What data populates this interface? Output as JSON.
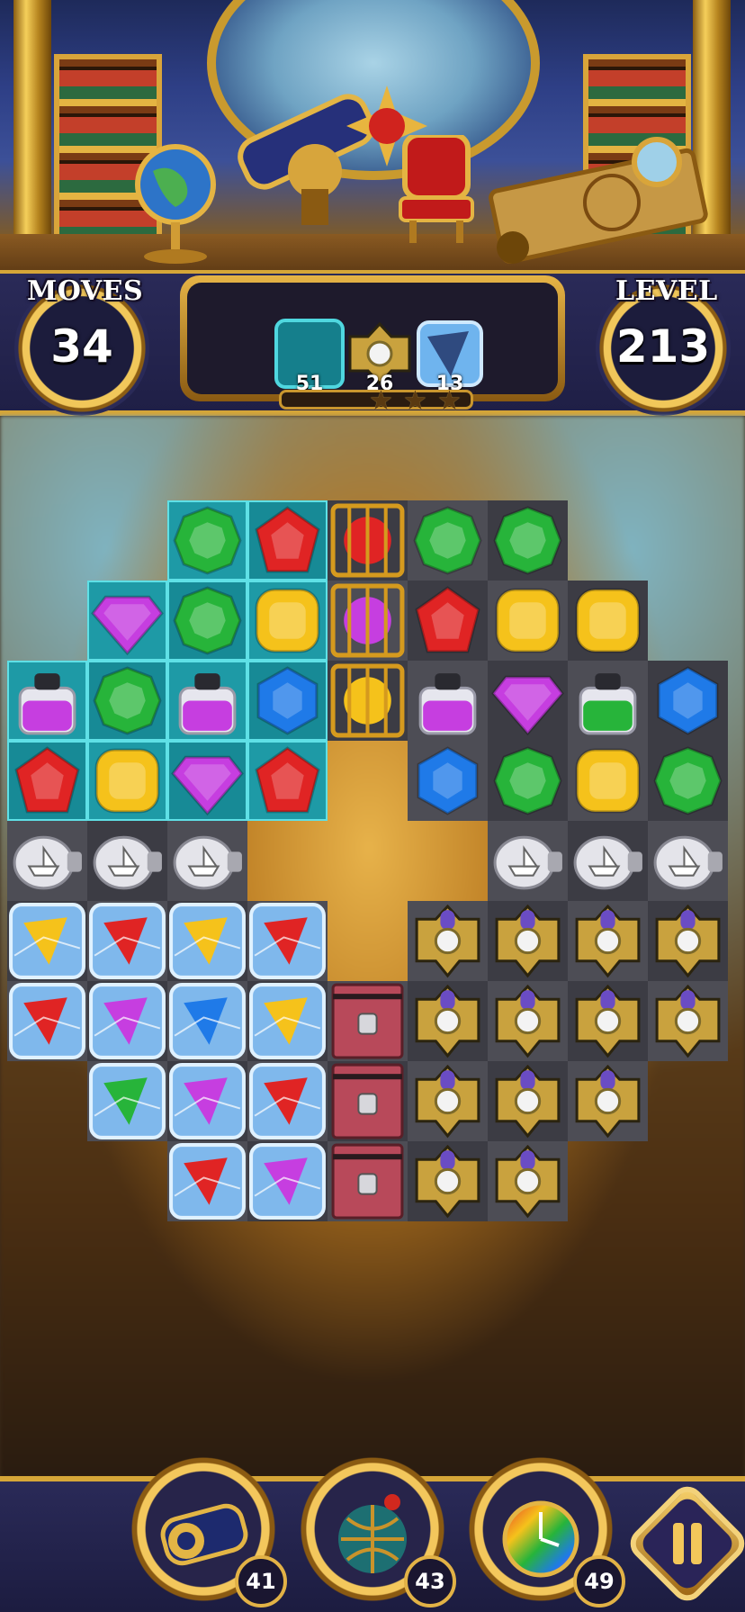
{
  "hud": {
    "moves_label": "MOVES",
    "moves_value": "34",
    "level_label": "LEVEL",
    "level_value": "213",
    "goals": [
      {
        "icon": "teal-tile-goal-icon",
        "count": "51"
      },
      {
        "icon": "golden-clover-goal-icon",
        "count": "26"
      },
      {
        "icon": "ice-block-goal-icon",
        "count": "13"
      }
    ],
    "stars_total": 3
  },
  "boosters": [
    {
      "icon": "cannon-telescope-icon",
      "count": "41"
    },
    {
      "icon": "caged-globe-bomb-icon",
      "count": "43"
    },
    {
      "icon": "rainbow-clock-icon",
      "count": "49"
    }
  ],
  "colors": {
    "red": "#e02424",
    "green": "#27b43a",
    "purple": "#c63ee0",
    "yellow": "#f5c21b",
    "blue": "#1f7ae8",
    "teal": "#1e9aa6",
    "gold": "#d6a638"
  },
  "board": {
    "rows": [
      [
        null,
        null,
        {
          "bg": "teal",
          "p": "green"
        },
        {
          "bg": "teal",
          "p": "red"
        },
        {
          "bg": "dark",
          "p": "caged-red"
        },
        {
          "bg": "light",
          "p": "green"
        },
        {
          "bg": "dark",
          "p": "green"
        },
        null,
        null
      ],
      [
        null,
        {
          "bg": "teal",
          "p": "purple"
        },
        {
          "bg": "teal",
          "p": "green"
        },
        {
          "bg": "teal",
          "p": "yellow"
        },
        {
          "bg": "light",
          "p": "caged-purple"
        },
        {
          "bg": "dark",
          "p": "red"
        },
        {
          "bg": "light",
          "p": "yellow"
        },
        {
          "bg": "dark",
          "p": "yellow"
        },
        null
      ],
      [
        {
          "bg": "teal",
          "p": "potion-purple"
        },
        {
          "bg": "teal",
          "p": "green"
        },
        {
          "bg": "teal",
          "p": "potion-purple"
        },
        {
          "bg": "teal",
          "p": "blue"
        },
        {
          "bg": "dark",
          "p": "caged-yellow"
        },
        {
          "bg": "light",
          "p": "potion-purple"
        },
        {
          "bg": "dark",
          "p": "purple"
        },
        {
          "bg": "light",
          "p": "potion-green"
        },
        {
          "bg": "dark",
          "p": "blue"
        }
      ],
      [
        {
          "bg": "teal",
          "p": "red"
        },
        {
          "bg": "teal",
          "p": "yellow"
        },
        {
          "bg": "teal",
          "p": "purple"
        },
        {
          "bg": "teal",
          "p": "red"
        },
        null,
        {
          "bg": "light",
          "p": "blue"
        },
        {
          "bg": "dark",
          "p": "green"
        },
        {
          "bg": "light",
          "p": "yellow"
        },
        {
          "bg": "dark",
          "p": "green"
        }
      ],
      [
        {
          "bg": "light",
          "p": "bottle"
        },
        {
          "bg": "dark",
          "p": "bottle"
        },
        {
          "bg": "light",
          "p": "bottle"
        },
        null,
        null,
        null,
        {
          "bg": "light",
          "p": "bottle"
        },
        {
          "bg": "dark",
          "p": "bottle"
        },
        {
          "bg": "light",
          "p": "bottle"
        }
      ],
      [
        {
          "bg": "dark",
          "p": "ice-yellow"
        },
        {
          "bg": "light",
          "p": "ice-red"
        },
        {
          "bg": "dark",
          "p": "ice-yellow"
        },
        {
          "bg": "light",
          "p": "ice-red"
        },
        null,
        {
          "bg": "light",
          "p": "clover"
        },
        {
          "bg": "dark",
          "p": "clover"
        },
        {
          "bg": "light",
          "p": "clover"
        },
        {
          "bg": "dark",
          "p": "clover"
        }
      ],
      [
        {
          "bg": "light",
          "p": "ice-red"
        },
        {
          "bg": "dark",
          "p": "ice-purple"
        },
        {
          "bg": "light",
          "p": "ice-blue"
        },
        {
          "bg": "dark",
          "p": "ice-yellow"
        },
        {
          "bg": "light",
          "p": "chest"
        },
        {
          "bg": "dark",
          "p": "clover"
        },
        {
          "bg": "light",
          "p": "clover"
        },
        {
          "bg": "dark",
          "p": "clover"
        },
        {
          "bg": "light",
          "p": "clover"
        }
      ],
      [
        null,
        {
          "bg": "light",
          "p": "ice-green"
        },
        {
          "bg": "dark",
          "p": "ice-purple"
        },
        {
          "bg": "light",
          "p": "ice-red"
        },
        {
          "bg": "dark",
          "p": "chest"
        },
        {
          "bg": "light",
          "p": "clover"
        },
        {
          "bg": "dark",
          "p": "clover"
        },
        {
          "bg": "light",
          "p": "clover"
        },
        null
      ],
      [
        null,
        null,
        {
          "bg": "light",
          "p": "ice-red"
        },
        {
          "bg": "dark",
          "p": "ice-purple"
        },
        {
          "bg": "light",
          "p": "chest"
        },
        {
          "bg": "dark",
          "p": "clover"
        },
        {
          "bg": "light",
          "p": "clover"
        },
        null,
        null
      ]
    ]
  }
}
